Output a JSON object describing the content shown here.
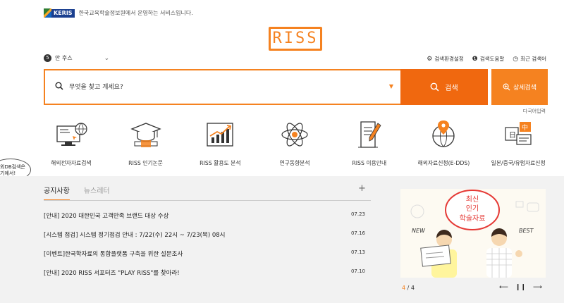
{
  "header": {
    "keris_logo": "KERIS",
    "keris_desc": "한국교육학술정보원에서 운영하는 서비스입니다.",
    "logo_text": "RISS"
  },
  "lang": {
    "number": "5",
    "label": "안 후스"
  },
  "util_links": [
    {
      "icon": "gear-icon",
      "label": "검색환경설정"
    },
    {
      "icon": "help-icon",
      "label": "검색도움말"
    },
    {
      "icon": "clock-icon",
      "label": "최근 검색어"
    }
  ],
  "search": {
    "placeholder": "무엇을 찾고 계세요?",
    "button_label": "검색",
    "advanced_label": "상세검색",
    "multi_lang": "다국어입력"
  },
  "quick_menu": [
    {
      "label": "해외전자자료검색",
      "icon": "computer-globe-icon"
    },
    {
      "label": "RISS 인기논문",
      "icon": "graduation-cap-icon"
    },
    {
      "label": "RISS 활용도 분석",
      "icon": "growth-chart-icon"
    },
    {
      "label": "연구동향분석",
      "icon": "atom-icon"
    },
    {
      "label": "RISS 이용안내",
      "icon": "document-pen-icon"
    },
    {
      "label": "해외자료신청(E-DDS)",
      "icon": "globe-pin-icon"
    },
    {
      "label": "일본/중국/유럽자료신청",
      "icon": "foreign-docs-icon"
    }
  ],
  "bubble": {
    "line1": "외DB검색은",
    "line2": "기에서!"
  },
  "notice": {
    "tab_active": "공지사항",
    "tab_other": "뉴스레터",
    "more": "+",
    "items": [
      {
        "title": "[안내] 2020 대한민국 고객만족 브랜드 대상 수상",
        "date": "07.23"
      },
      {
        "title": "[시스템 점검] 시스템 정기점검 안내 : 7/22(수) 22시 ~ 7/23(목) 08시",
        "date": "07.16"
      },
      {
        "title": "[이벤트]한국학자료의 통합플랫폼 구축을 위한 설문조사",
        "date": "07.13"
      },
      {
        "title": "[안내] 2020 RISS 서포터즈 \"PLAY RISS\"를 찾아라!",
        "date": "07.10"
      }
    ]
  },
  "banner": {
    "line1": "최신",
    "line2": "인기",
    "line3": "학술자료",
    "new_label": "NEW",
    "best_label": "BEST",
    "current": "4",
    "total": "/ 4"
  },
  "colors": {
    "accent": "#f58220",
    "search_btn": "#f0680f",
    "keris_blue": "#1a3f8f"
  }
}
